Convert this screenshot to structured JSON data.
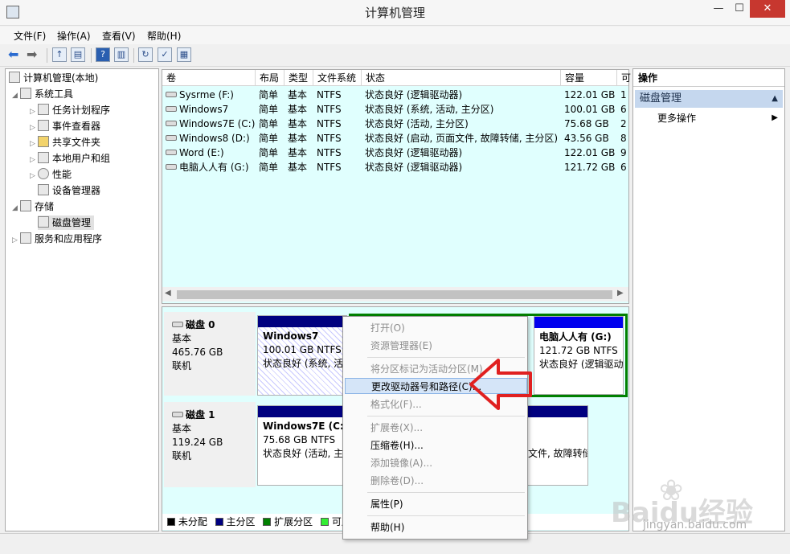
{
  "window": {
    "title": "计算机管理",
    "min": "—",
    "max": "☐",
    "close": "✕"
  },
  "menu": [
    "文件(F)",
    "操作(A)",
    "查看(V)",
    "帮助(H)"
  ],
  "tree": {
    "root": "计算机管理(本地)",
    "system_tools": "系统工具",
    "task_scheduler": "任务计划程序",
    "event_viewer": "事件查看器",
    "shared_folders": "共享文件夹",
    "local_users": "本地用户和组",
    "performance": "性能",
    "device_manager": "设备管理器",
    "storage": "存储",
    "disk_management": "磁盘管理",
    "services_apps": "服务和应用程序"
  },
  "volume_table": {
    "headers": [
      "卷",
      "布局",
      "类型",
      "文件系统",
      "状态",
      "容量",
      "可"
    ],
    "rows": [
      [
        "Sysrme (F:)",
        "简单",
        "基本",
        "NTFS",
        "状态良好 (逻辑驱动器)",
        "122.01 GB",
        "1"
      ],
      [
        "Windows7",
        "简单",
        "基本",
        "NTFS",
        "状态良好 (系统, 活动, 主分区)",
        "100.01 GB",
        "6"
      ],
      [
        "Windows7E (C:)",
        "简单",
        "基本",
        "NTFS",
        "状态良好 (活动, 主分区)",
        "75.68 GB",
        "2"
      ],
      [
        "Windows8 (D:)",
        "简单",
        "基本",
        "NTFS",
        "状态良好 (启动, 页面文件, 故障转储, 主分区)",
        "43.56 GB",
        "8"
      ],
      [
        "Word (E:)",
        "简单",
        "基本",
        "NTFS",
        "状态良好 (逻辑驱动器)",
        "122.01 GB",
        "9"
      ],
      [
        "电脑人人有 (G:)",
        "简单",
        "基本",
        "NTFS",
        "状态良好 (逻辑驱动器)",
        "121.72 GB",
        "6"
      ]
    ]
  },
  "disks": [
    {
      "name": "磁盘 0",
      "type": "基本",
      "size": "465.76 GB",
      "state": "联机",
      "partitions": [
        {
          "title": "Windows7",
          "line1": "100.01 GB NTFS",
          "line2": "状态良好 (系统, 活"
        },
        {
          "title": "电脑人人有  (G:)",
          "line1": "121.72 GB NTFS",
          "line2": "状态良好 (逻辑驱动"
        }
      ]
    },
    {
      "name": "磁盘 1",
      "type": "基本",
      "size": "119.24 GB",
      "state": "联机",
      "partitions": [
        {
          "title": "Windows7E  (C:)",
          "line1": "75.68 GB NTFS",
          "line2": "状态良好 (活动, 主"
        },
        {
          "title": "",
          "line1": "",
          "line2": "文件, 故障转储"
        }
      ]
    }
  ],
  "legend": [
    {
      "label": "未分配",
      "color": "#000000"
    },
    {
      "label": "主分区",
      "color": "#000080"
    },
    {
      "label": "扩展分区",
      "color": "#008000"
    },
    {
      "label": "可用",
      "color": "#33ee33"
    }
  ],
  "actions": {
    "title": "操作",
    "section": "磁盘管理",
    "more": "更多操作"
  },
  "context_menu": {
    "items": [
      {
        "label": "打开(O)",
        "enabled": false
      },
      {
        "label": "资源管理器(E)",
        "enabled": false
      },
      {
        "label": "将分区标记为活动分区(M)",
        "enabled": false
      },
      {
        "label": "更改驱动器号和路径(C)...",
        "enabled": true,
        "highlighted": true
      },
      {
        "label": "格式化(F)...",
        "enabled": false
      },
      {
        "label": "扩展卷(X)...",
        "enabled": false
      },
      {
        "label": "压缩卷(H)...",
        "enabled": true
      },
      {
        "label": "添加镜像(A)...",
        "enabled": false
      },
      {
        "label": "删除卷(D)...",
        "enabled": false
      },
      {
        "label": "属性(P)",
        "enabled": true
      },
      {
        "label": "帮助(H)",
        "enabled": true
      }
    ]
  },
  "watermark": {
    "brand": "Baidu经验",
    "url": "jingyan.baidu.com"
  },
  "colors": {
    "primary_partition": "#000080",
    "extended_partition": "#008000",
    "arrow_annotation": "#e02020",
    "list_background": "#e0fffe"
  }
}
